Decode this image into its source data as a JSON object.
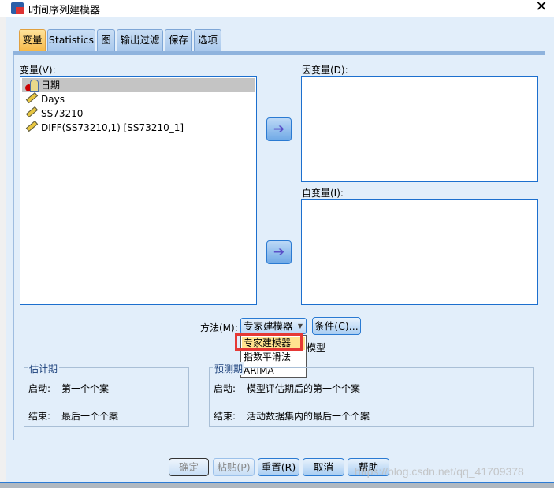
{
  "window": {
    "title": "时间序列建模器",
    "close": "✕"
  },
  "tabs": [
    {
      "label": "变量",
      "selected": true
    },
    {
      "label": "Statistics"
    },
    {
      "label": "图"
    },
    {
      "label": "输出过滤"
    },
    {
      "label": "保存"
    },
    {
      "label": "选项"
    }
  ],
  "variables": {
    "label": "变量(V):",
    "items": [
      {
        "name": "日期",
        "icon": "date-nominal-icon",
        "selected": true
      },
      {
        "name": "Days",
        "icon": "scale-ruler-icon"
      },
      {
        "name": "SS73210",
        "icon": "scale-ruler-icon"
      },
      {
        "name": "DIFF(SS73210,1) [SS73210_1]",
        "icon": "scale-ruler-icon"
      }
    ]
  },
  "dependent": {
    "label": "因变量(D):"
  },
  "independent": {
    "label": "自变量(I):"
  },
  "arrow": "➔",
  "method": {
    "label": "方法(M):",
    "value": "专家建模器",
    "arrow": "▼",
    "options": [
      "专家建模器",
      "指数平滑法",
      "ARIMA"
    ],
    "criteria_button": "条件(C)...",
    "hidden_text_fragment": "模型"
  },
  "estimation": {
    "title": "估计期",
    "start_label": "启动:",
    "start_value": "第一个个案",
    "end_label": "结束:",
    "end_value": "最后一个个案"
  },
  "forecast": {
    "title": "预测期",
    "start_label": "启动:",
    "start_value": "模型评估期后的第一个个案",
    "end_label": "结束:",
    "end_value": "活动数据集内的最后一个个案"
  },
  "buttons": {
    "ok": "确定",
    "paste": "粘贴(P)",
    "reset": "重置(R)",
    "cancel": "取消",
    "help": "帮助"
  },
  "watermark": "https://blog.csdn.net/qq_41709378",
  "colors": {
    "accent": "#1c6fce",
    "highlight_border": "#e53935",
    "selected_option": "#ffe38f"
  }
}
